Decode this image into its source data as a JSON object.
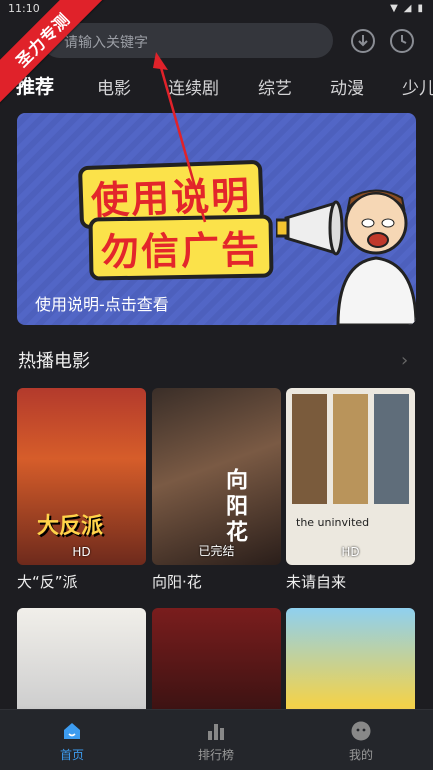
{
  "status_bar": {
    "time": "11:10"
  },
  "ribbon": {
    "text": "圣力专测"
  },
  "search": {
    "placeholder": "请输入关键字"
  },
  "tabs": [
    "推荐",
    "电影",
    "连续剧",
    "综艺",
    "动漫",
    "少儿"
  ],
  "banner": {
    "line1": "使用说明",
    "line2": "勿信广告",
    "caption": "使用说明-点击查看"
  },
  "section": {
    "title": "热播电影",
    "more": "›"
  },
  "movies": [
    {
      "title": "大“反”派",
      "badge": "HD",
      "poster_text": "大反派"
    },
    {
      "title": "向阳·花",
      "badge": "已完结",
      "poster_text": "向阳花"
    },
    {
      "title": "未请自来",
      "badge": "HD",
      "poster_text": "the uninvited"
    },
    {
      "title": "",
      "badge": "",
      "poster_text": ""
    },
    {
      "title": "",
      "badge": "",
      "poster_text": ""
    },
    {
      "title": "",
      "badge": "",
      "poster_text": ""
    }
  ],
  "bottom_nav": [
    {
      "label": "首页",
      "icon": "home-icon",
      "active": true
    },
    {
      "label": "排行榜",
      "icon": "rank-icon",
      "active": false
    },
    {
      "label": "我的",
      "icon": "profile-icon",
      "active": false
    }
  ],
  "colors": {
    "accent": "#3d9cf0",
    "ribbon": "#e0222a",
    "banner": "#5266c6"
  }
}
